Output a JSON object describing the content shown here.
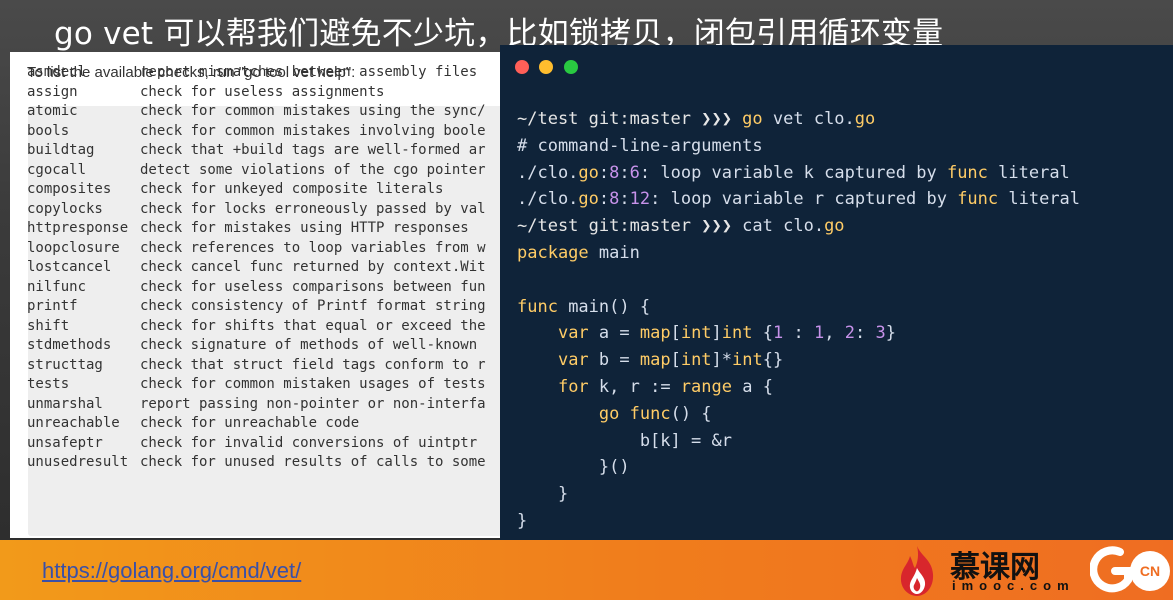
{
  "slide": {
    "title": "go vet 可以帮我们避免不少坑，比如锁拷贝，闭包引用循环变量"
  },
  "doc": {
    "intro": "To list the available checks, run \"go tool vet help\":",
    "checks": [
      {
        "name": "asmdecl",
        "desc": "report mismatches between assembly files"
      },
      {
        "name": "assign",
        "desc": "check for useless assignments"
      },
      {
        "name": "atomic",
        "desc": "check for common mistakes using the sync/"
      },
      {
        "name": "bools",
        "desc": "check for common mistakes involving boole"
      },
      {
        "name": "buildtag",
        "desc": "check that +build tags are well-formed ar"
      },
      {
        "name": "cgocall",
        "desc": "detect some violations of the cgo pointer"
      },
      {
        "name": "composites",
        "desc": "check for unkeyed composite literals"
      },
      {
        "name": "copylocks",
        "desc": "check for locks erroneously passed by val"
      },
      {
        "name": "httpresponse",
        "desc": "check for mistakes using HTTP responses"
      },
      {
        "name": "loopclosure",
        "desc": "check references to loop variables from w"
      },
      {
        "name": "lostcancel",
        "desc": "check cancel func returned by context.Wit"
      },
      {
        "name": "nilfunc",
        "desc": "check for useless comparisons between fun"
      },
      {
        "name": "printf",
        "desc": "check consistency of Printf format string"
      },
      {
        "name": "shift",
        "desc": "check for shifts that equal or exceed the"
      },
      {
        "name": "stdmethods",
        "desc": "check signature of methods of well-known"
      },
      {
        "name": "structtag",
        "desc": "check that struct field tags conform to r"
      },
      {
        "name": "tests",
        "desc": "check for common mistaken usages of tests"
      },
      {
        "name": "unmarshal",
        "desc": "report passing non-pointer or non-interfa"
      },
      {
        "name": "unreachable",
        "desc": "check for unreachable code"
      },
      {
        "name": "unsafeptr",
        "desc": "check for invalid conversions of uintptr"
      },
      {
        "name": "unusedresult",
        "desc": "check for unused results of calls to some"
      }
    ]
  },
  "terminal": {
    "lines": [
      [
        {
          "t": "~/test git:master ❯❯❯ ",
          "c": "prompt"
        },
        {
          "t": "go",
          "c": "kw"
        },
        {
          "t": " vet clo.",
          "c": "cmt"
        },
        {
          "t": "go",
          "c": "kw"
        }
      ],
      [
        {
          "t": "# command-line-arguments",
          "c": "cmt"
        }
      ],
      [
        {
          "t": "./clo.",
          "c": "cmt"
        },
        {
          "t": "go",
          "c": "kw"
        },
        {
          "t": ":",
          "c": "cmt"
        },
        {
          "t": "8",
          "c": "num"
        },
        {
          "t": ":",
          "c": "cmt"
        },
        {
          "t": "6",
          "c": "num"
        },
        {
          "t": ": loop variable k captured by ",
          "c": "cmt"
        },
        {
          "t": "func",
          "c": "kw"
        },
        {
          "t": " literal",
          "c": "cmt"
        }
      ],
      [
        {
          "t": "./clo.",
          "c": "cmt"
        },
        {
          "t": "go",
          "c": "kw"
        },
        {
          "t": ":",
          "c": "cmt"
        },
        {
          "t": "8",
          "c": "num"
        },
        {
          "t": ":",
          "c": "cmt"
        },
        {
          "t": "12",
          "c": "num"
        },
        {
          "t": ": loop variable r captured by ",
          "c": "cmt"
        },
        {
          "t": "func",
          "c": "kw"
        },
        {
          "t": " literal",
          "c": "cmt"
        }
      ],
      [
        {
          "t": "~/test git:master ❯❯❯ ",
          "c": "prompt"
        },
        {
          "t": "cat clo.",
          "c": "cmt"
        },
        {
          "t": "go",
          "c": "kw"
        }
      ],
      [
        {
          "t": "package",
          "c": "kw"
        },
        {
          "t": " main",
          "c": "cmt"
        }
      ],
      [
        {
          "t": "",
          "c": "cmt"
        }
      ],
      [
        {
          "t": "func",
          "c": "kw"
        },
        {
          "t": " main() {",
          "c": "cmt"
        }
      ],
      [
        {
          "t": "    ",
          "c": "cmt"
        },
        {
          "t": "var",
          "c": "kw"
        },
        {
          "t": " a = ",
          "c": "cmt"
        },
        {
          "t": "map",
          "c": "kw"
        },
        {
          "t": "[",
          "c": "cmt"
        },
        {
          "t": "int",
          "c": "kw"
        },
        {
          "t": "]",
          "c": "cmt"
        },
        {
          "t": "int",
          "c": "kw"
        },
        {
          "t": " {",
          "c": "cmt"
        },
        {
          "t": "1",
          "c": "num"
        },
        {
          "t": " : ",
          "c": "cmt"
        },
        {
          "t": "1",
          "c": "num"
        },
        {
          "t": ", ",
          "c": "cmt"
        },
        {
          "t": "2",
          "c": "num"
        },
        {
          "t": ": ",
          "c": "cmt"
        },
        {
          "t": "3",
          "c": "num"
        },
        {
          "t": "}",
          "c": "cmt"
        }
      ],
      [
        {
          "t": "    ",
          "c": "cmt"
        },
        {
          "t": "var",
          "c": "kw"
        },
        {
          "t": " b = ",
          "c": "cmt"
        },
        {
          "t": "map",
          "c": "kw"
        },
        {
          "t": "[",
          "c": "cmt"
        },
        {
          "t": "int",
          "c": "kw"
        },
        {
          "t": "]*",
          "c": "cmt"
        },
        {
          "t": "int",
          "c": "kw"
        },
        {
          "t": "{}",
          "c": "cmt"
        }
      ],
      [
        {
          "t": "    ",
          "c": "cmt"
        },
        {
          "t": "for",
          "c": "kw"
        },
        {
          "t": " k, r := ",
          "c": "cmt"
        },
        {
          "t": "range",
          "c": "kw"
        },
        {
          "t": " a {",
          "c": "cmt"
        }
      ],
      [
        {
          "t": "        ",
          "c": "cmt"
        },
        {
          "t": "go",
          "c": "kw"
        },
        {
          "t": " ",
          "c": "cmt"
        },
        {
          "t": "func",
          "c": "kw"
        },
        {
          "t": "() {",
          "c": "cmt"
        }
      ],
      [
        {
          "t": "            b[k] = &r",
          "c": "cmt"
        }
      ],
      [
        {
          "t": "        }()",
          "c": "cmt"
        }
      ],
      [
        {
          "t": "    }",
          "c": "cmt"
        }
      ],
      [
        {
          "t": "}",
          "c": "cmt"
        }
      ]
    ]
  },
  "footer": {
    "link": "https://golang.org/cmd/vet/",
    "imooc_name": "慕课网",
    "imooc_domain": "imooc.com",
    "gocn_text": "CN"
  }
}
